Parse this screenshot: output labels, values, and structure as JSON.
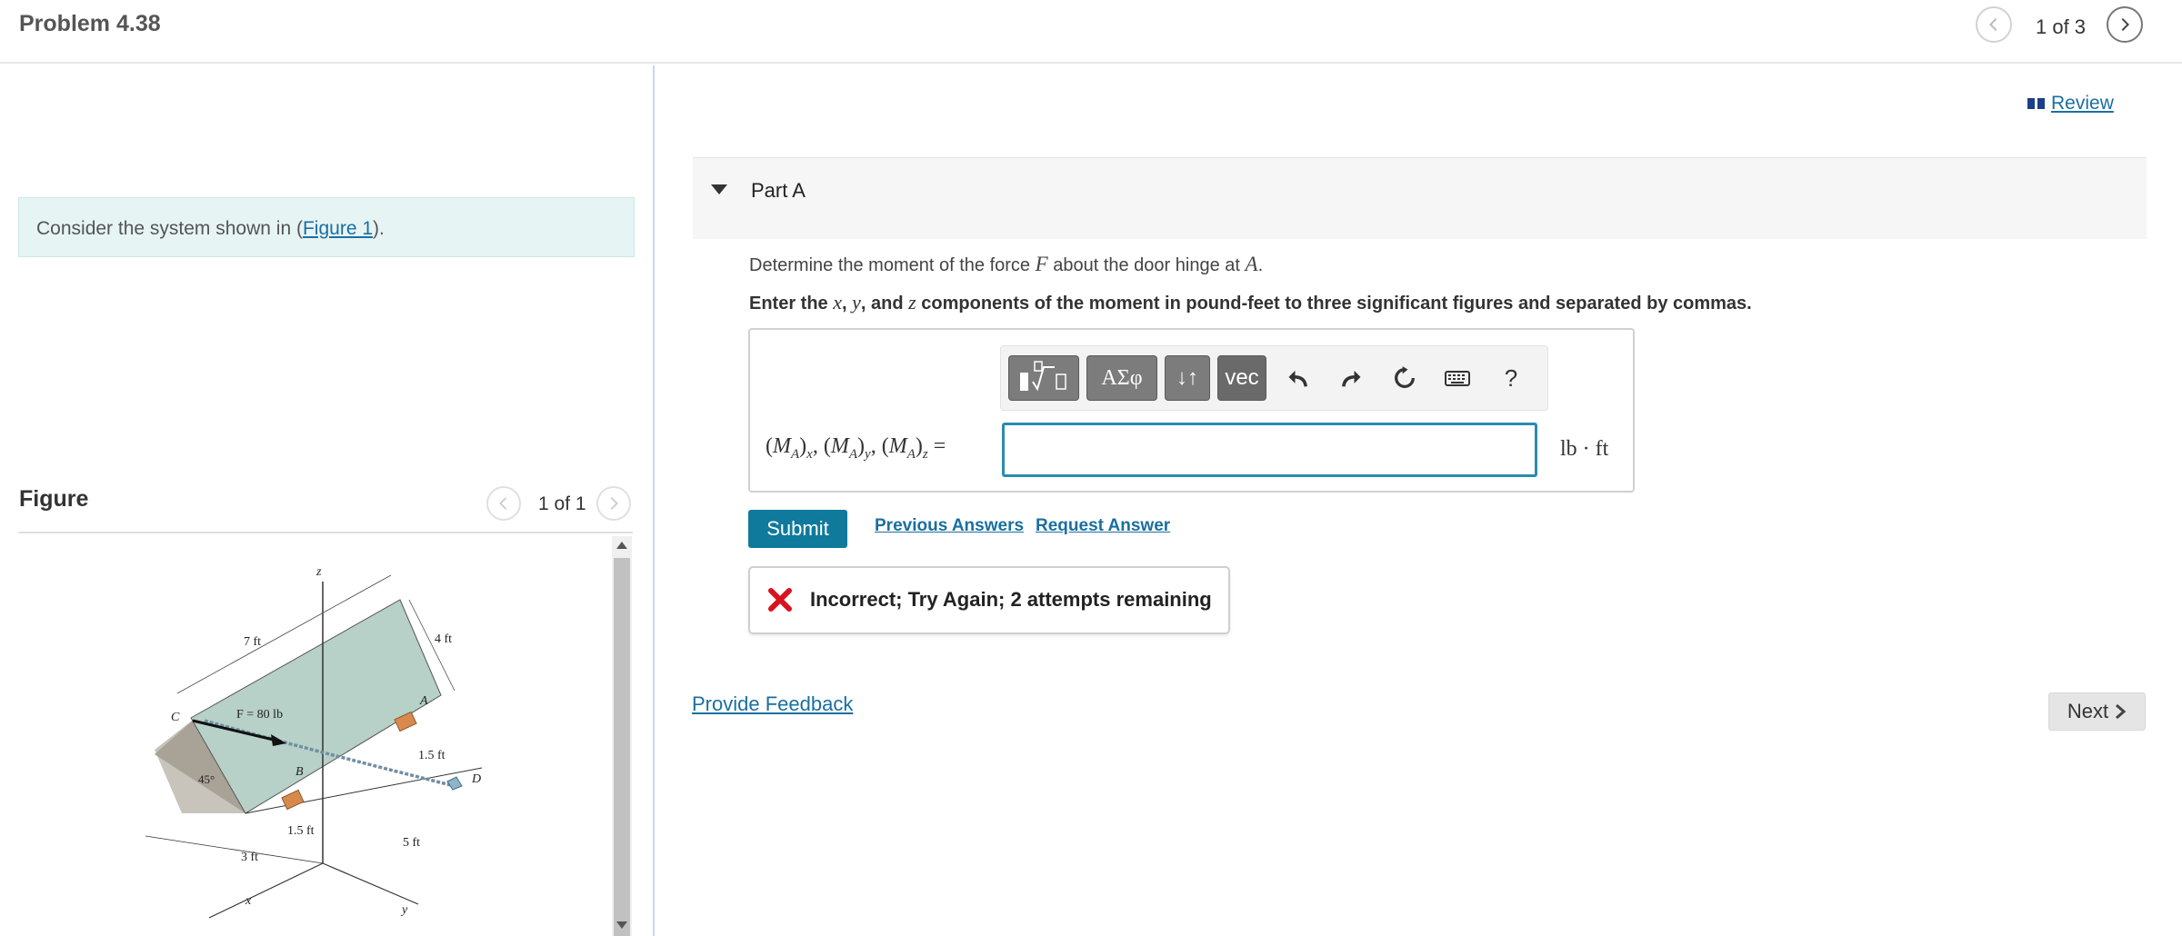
{
  "header": {
    "title": "Problem 4.38",
    "pager": "1 of 3"
  },
  "left": {
    "consider_prefix": "Consider the system shown in (",
    "consider_link": "Figure 1",
    "consider_suffix": ").",
    "figure_heading": "Figure",
    "figure_pager": "1 of 1",
    "figure_labels": {
      "z": "z",
      "x": "x",
      "y": "y",
      "C": "C",
      "A": "A",
      "B": "B",
      "D": "D",
      "dim_7ft": "7 ft",
      "dim_4ft": "4 ft",
      "force": "F = 80 lb",
      "dim_1_5ft_a": "1.5 ft",
      "dim_1_5ft_b": "1.5 ft",
      "angle": "45°",
      "dim_3ft": "3 ft",
      "dim_5ft": "5 ft"
    }
  },
  "right": {
    "review": "Review",
    "part_title": "Part A",
    "question_prefix": "Determine the moment of the force ",
    "question_F": "F",
    "question_mid": " about the door hinge at ",
    "question_A": "A",
    "question_suffix": ".",
    "instruction_1": "Enter the ",
    "instruction_x": "x",
    "instruction_2": ", ",
    "instruction_y": "y",
    "instruction_3": ", and ",
    "instruction_z": "z",
    "instruction_4": " components of the moment in pound-feet to three significant figures and separated by commas.",
    "toolbar": {
      "greek": "ΑΣφ",
      "arrows": "↓↑",
      "vec": "vec",
      "help": "?"
    },
    "answer_label_html": "(M<sub>A</sub>)<sub>x</sub>, (M<sub>A</sub>)<sub>y</sub>, (M<sub>A</sub>)<sub>z</sub> =",
    "answer_value": "",
    "unit": "lb · ft",
    "submit": "Submit",
    "previous_answers": "Previous Answers",
    "request_answer": "Request Answer",
    "feedback": "Incorrect; Try Again; 2 attempts remaining",
    "provide_feedback": "Provide Feedback",
    "next": "Next"
  },
  "colors": {
    "accent": "#0f7a9b",
    "link": "#1a6fa0",
    "error": "#d9121f",
    "door": "#b7d0c8"
  }
}
